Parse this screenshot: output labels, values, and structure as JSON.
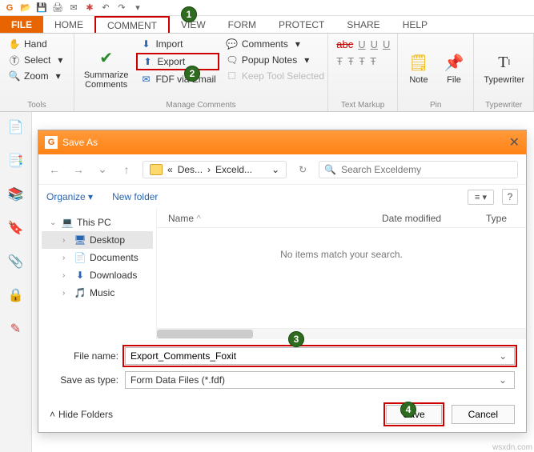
{
  "badges": {
    "b1": "1",
    "b2": "2",
    "b3": "3",
    "b4": "4"
  },
  "tabs": {
    "file": "FILE",
    "home": "HOME",
    "comment": "COMMENT",
    "view": "VIEW",
    "form": "FORM",
    "protect": "PROTECT",
    "share": "SHARE",
    "help": "HELP"
  },
  "tools_group": {
    "label": "Tools",
    "hand": "Hand",
    "select": "Select",
    "zoom": "Zoom"
  },
  "manage_group": {
    "label": "Manage Comments",
    "summarize": "Summarize\nComments",
    "import": "Import",
    "export": "Export",
    "fdf": "FDF via Email",
    "comments": "Comments",
    "popup": "Popup Notes",
    "keep": "Keep Tool Selected"
  },
  "textmarkup_group": {
    "label": "Text Markup"
  },
  "pin_group": {
    "label": "Pin",
    "note": "Note",
    "file": "File"
  },
  "typewriter_group": {
    "label": "Typewriter",
    "typewriter": "Typewriter"
  },
  "dialog": {
    "title": "Save As",
    "crumb_left": "Des...",
    "crumb_right": "Exceld...",
    "search_placeholder": "Search Exceldemy",
    "organize": "Organize",
    "newfolder": "New folder",
    "col_name": "Name",
    "col_date": "Date modified",
    "col_type": "Type",
    "empty": "No items match your search.",
    "tree": {
      "thispc": "This PC",
      "desktop": "Desktop",
      "documents": "Documents",
      "downloads": "Downloads",
      "music": "Music"
    },
    "filename_label": "File name:",
    "filename_value": "Export_Comments_Foxit",
    "saveastype_label": "Save as type:",
    "saveastype_value": "Form Data Files (*.fdf)",
    "hidefolders": "Hide Folders",
    "save": "Save",
    "cancel": "Cancel"
  },
  "watermark": "wsxdn.com"
}
